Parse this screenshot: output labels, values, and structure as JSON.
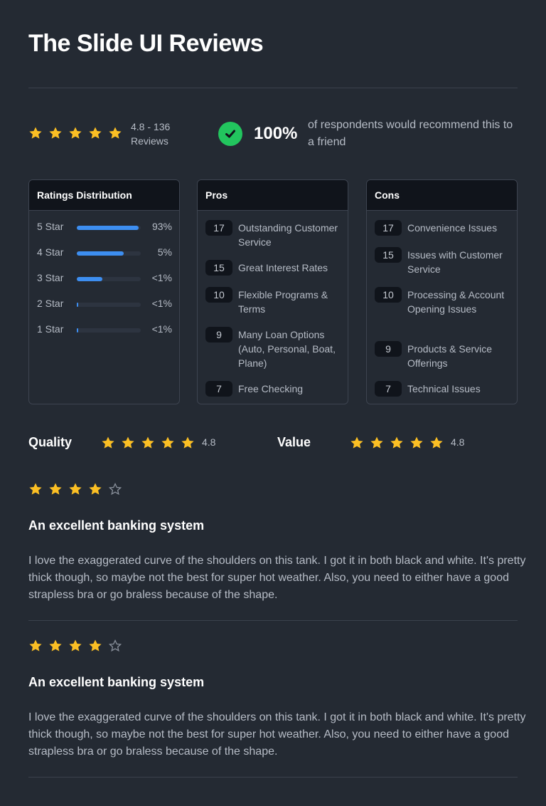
{
  "page": {
    "title": "The Slide UI Reviews"
  },
  "colors": {
    "background": "#242a33",
    "star": "#fbbf24",
    "accent_bar": "#3d8ef0",
    "check": "#22c55e"
  },
  "summary": {
    "stars": 5,
    "rating_line1": "4.8 - 136",
    "rating_line2": "Reviews",
    "recommend_pct": "100%",
    "recommend_text": "of respondents would recommend this to a friend",
    "icon": "check-circle-icon"
  },
  "distribution": {
    "title": "Ratings Distribution",
    "rows": [
      {
        "label": "5 Star",
        "pct": "93%",
        "fill": 0.97
      },
      {
        "label": "4 Star",
        "pct": "5%",
        "fill": 0.73
      },
      {
        "label": "3 Star",
        "pct": "<1%",
        "fill": 0.4
      },
      {
        "label": "2 Star",
        "pct": "<1%",
        "fill": 0.02
      },
      {
        "label": "1 Star",
        "pct": "<1%",
        "fill": 0.02
      }
    ]
  },
  "pros": {
    "title": "Pros",
    "items": [
      {
        "count": "17",
        "label": "Outstanding Customer Service"
      },
      {
        "count": "15",
        "label": "Great Interest Rates"
      },
      {
        "count": "10",
        "label": "Flexible Programs & Terms"
      },
      {
        "count": "9",
        "label": "Many Loan Options (Auto, Personal, Boat, Plane)"
      },
      {
        "count": "7",
        "label": "Free Checking"
      }
    ]
  },
  "cons": {
    "title": "Cons",
    "items": [
      {
        "count": "17",
        "label": "Convenience Issues"
      },
      {
        "count": "15",
        "label": "Issues with Customer Service"
      },
      {
        "count": "10",
        "label": "Processing & Account Opening Issues"
      },
      {
        "count": "9",
        "label": "Products & Service Offerings"
      },
      {
        "count": "7",
        "label": "Technical Issues"
      }
    ]
  },
  "scores": {
    "quality": {
      "label": "Quality",
      "value": "4.8",
      "stars": 5
    },
    "value": {
      "label": "Value",
      "value": "4.8",
      "stars": 5
    }
  },
  "reviews": [
    {
      "stars": 4,
      "title": "An excellent banking system",
      "body": "I love the exaggerated curve of the shoulders on this tank. I got it in both black and white. It's pretty thick though, so maybe not the best for super hot weather. Also, you need to either have a good strapless bra or go braless because of the shape."
    },
    {
      "stars": 4,
      "title": "An excellent banking system",
      "body": "I love the exaggerated curve of the shoulders on this tank. I got it in both black and white. It's pretty thick though, so maybe not the best for super hot weather. Also, you need to either have a good strapless bra or go braless because of the shape."
    }
  ]
}
